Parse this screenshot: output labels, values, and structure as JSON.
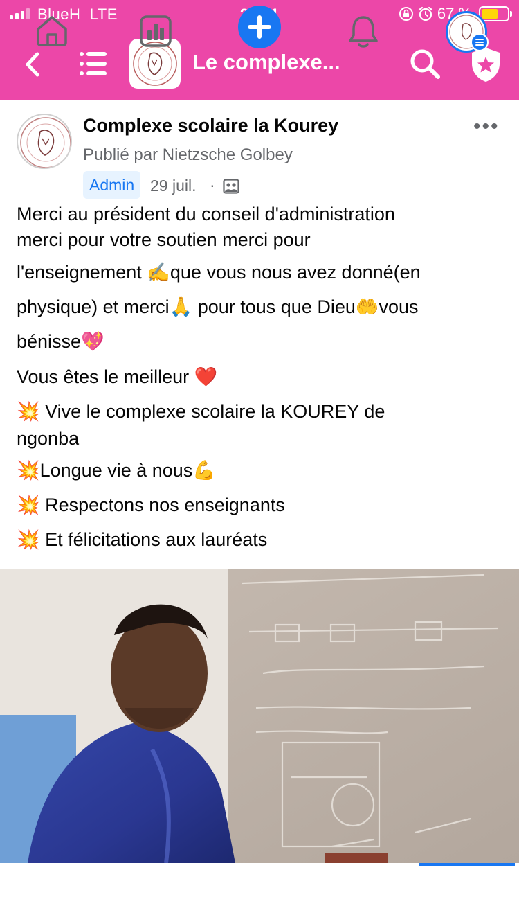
{
  "status_bar": {
    "carrier": "BlueH",
    "network": "LTE",
    "time": "23:01",
    "battery": "67 %",
    "battery_level": 0.67,
    "battery_color": "#ffd60a"
  },
  "header": {
    "title": "Le complexe...",
    "background": "#ec47a8",
    "icons": [
      "back-icon",
      "menu-icon",
      "page-logo",
      "search-icon",
      "shield-icon"
    ]
  },
  "post": {
    "page_name": "Complexe scolaire la Kourey",
    "posted_by": "Publié par Nietzsche Golbey",
    "role_badge": "Admin",
    "date": "29 juil.",
    "separator": "·",
    "more": "•••",
    "lines": [
      "Merci au président du conseil d'administration",
      "merci pour votre soutien merci pour",
      "l'enseignement ✍️que vous nous avez donné(en",
      "physique) et merci🙏 pour tous que Dieu🤲vous",
      "bénisse💖",
      "Vous êtes le meilleur ❤️",
      "💥 Vive le complexe scolaire la KOUREY de",
      "ngonba",
      "💥Longue vie à nous💪",
      "💥 Respectons nos enseignants",
      "💥 Et félicitations aux lauréats"
    ]
  },
  "bottom_nav": {
    "items": [
      "home-icon",
      "insights-icon",
      "create-icon",
      "notifications-icon",
      "profile-icon"
    ],
    "active": "profile-icon",
    "accent": "#1877f2"
  }
}
